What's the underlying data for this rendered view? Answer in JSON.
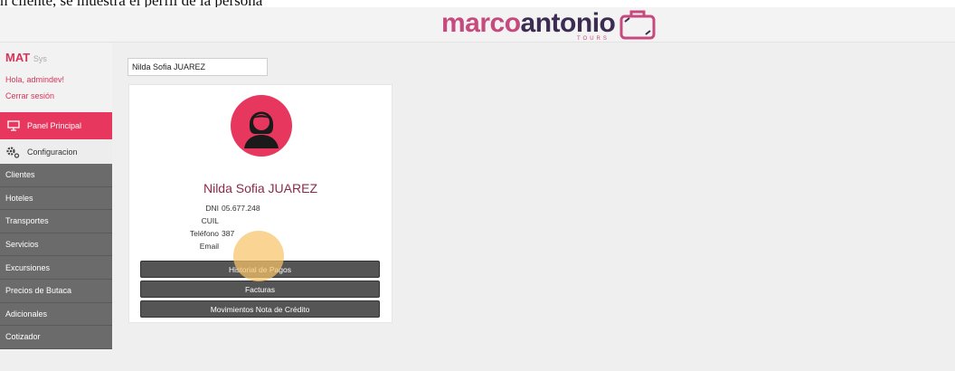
{
  "caption": "n cliente, se muestra el perfil de la persona",
  "header": {
    "logo_marco": "marco",
    "logo_antonio": "antonio",
    "logo_tours": "TOURS"
  },
  "sidebar": {
    "brand": "MAT",
    "brand_suffix": "Sys",
    "greeting": "Hola, admindev!",
    "logout": "Cerrar sesión",
    "panel": "Panel Principal",
    "config": "Configuracion",
    "items": [
      {
        "label": "Clientes"
      },
      {
        "label": "Hoteles"
      },
      {
        "label": "Transportes"
      },
      {
        "label": "Servicios"
      },
      {
        "label": "Excursiones"
      },
      {
        "label": "Precios de Butaca"
      },
      {
        "label": "Adicionales"
      },
      {
        "label": "Cotizador"
      }
    ]
  },
  "search": {
    "value": "Nilda Sofia JUAREZ"
  },
  "profile": {
    "name": "Nilda Sofia JUAREZ",
    "dni_label": "DNI",
    "dni": "05.677.248",
    "cuil_label": "CUIL",
    "cuil": "",
    "phone_label": "Teléfono",
    "phone": "387",
    "email_label": "Email",
    "email": ""
  },
  "buttons": {
    "pagos": "Historial de Pagos",
    "facturas": "Facturas",
    "movimientos": "Movimientos Nota de Crédito"
  },
  "colors": {
    "accent": "#e8375e",
    "menu_bg": "#6b6b6b",
    "logo_pink": "#c64a7d",
    "logo_dark": "#3c2c52"
  }
}
